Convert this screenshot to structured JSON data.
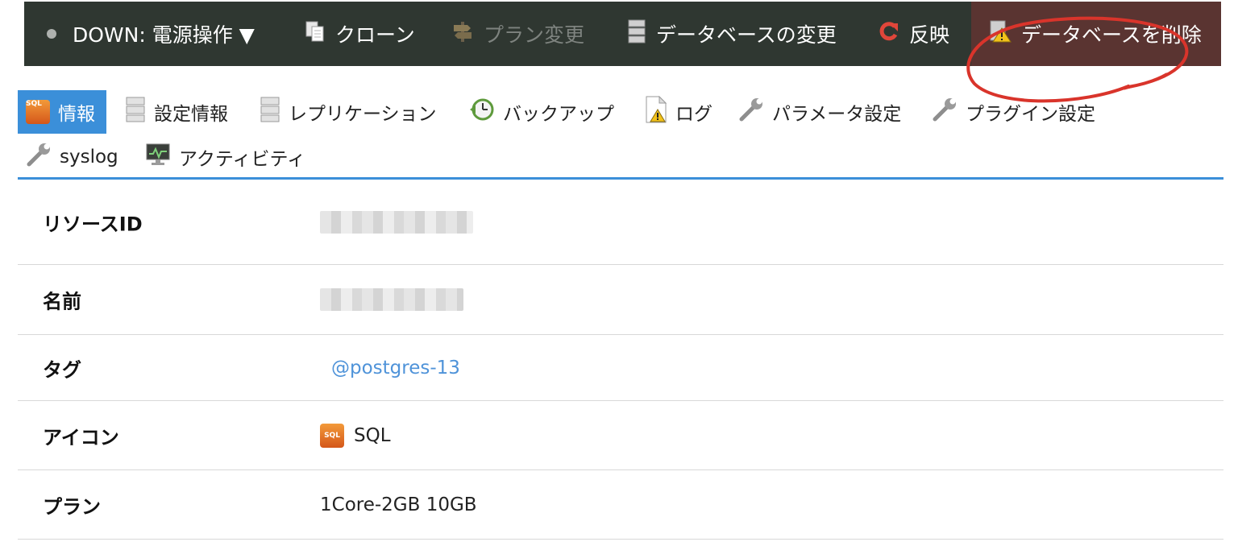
{
  "toolbar": {
    "power_label": "DOWN: 電源操作 ▼",
    "clone_label": "クローン",
    "plan_change_label": "プラン変更",
    "db_change_label": "データベースの変更",
    "reflect_label": "反映",
    "delete_label": "データベースを削除"
  },
  "tabs": {
    "info": "情報",
    "settings": "設定情報",
    "replication": "レプリケーション",
    "backup": "バックアップ",
    "log": "ログ",
    "parameter": "パラメータ設定",
    "plugin": "プラグイン設定",
    "syslog": "syslog",
    "activity": "アクティビティ"
  },
  "info": {
    "resource_id_label": "リソースID",
    "name_label": "名前",
    "tag_label": "タグ",
    "tag_value": "@postgres-13",
    "icon_label": "アイコン",
    "icon_value": "SQL",
    "plan_label": "プラン",
    "plan_value": "1Core-2GB 10GB"
  },
  "icons": {
    "badge_text": "SQL"
  },
  "colors": {
    "toolbar_bg": "#2f3731",
    "danger_bg": "#5a3431",
    "accent": "#3b8fd9",
    "reflect_icon": "#e0463a",
    "annotation": "#d9342b"
  }
}
